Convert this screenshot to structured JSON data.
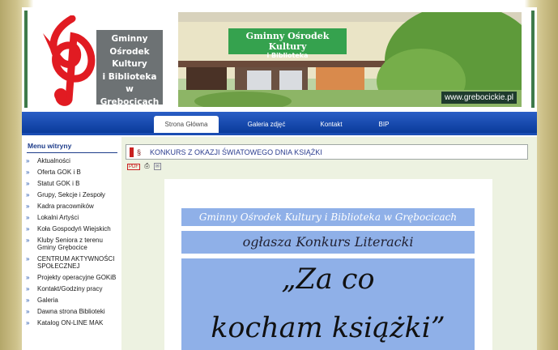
{
  "header": {
    "logo_lines": [
      "Gminny",
      "Ośrodek",
      "Kultury",
      "i Biblioteka",
      "w Grębocicach"
    ],
    "photo_sign_line1": "Gminny Ośrodek Kultury",
    "photo_sign_line2": "i Biblioteka",
    "url_badge": "www.grebocickie.pl"
  },
  "nav": {
    "items": [
      "Strona Główna",
      "Galeria zdjęć",
      "Kontakt",
      "BIP"
    ],
    "active": "Strona Główna"
  },
  "sidebar": {
    "title": "Menu witryny",
    "items": [
      "Aktualności",
      "Oferta GOK i B",
      "Statut GOK i B",
      "Grupy, Sekcje i Zespoły",
      "Kadra pracowników",
      "Lokalni Artyści",
      "Koła Gospodyń Wiejskich",
      "Kluby Seniora z terenu Gminy Grębocice",
      "CENTRUM AKTYWNOŚCI SPOŁECZNEJ",
      "Projekty operacyjne GOKiB",
      "Kontakt/Godziny pracy",
      "Galeria",
      "Dawna strona Biblioteki",
      "Katalog ON-LINE MAK"
    ]
  },
  "article": {
    "title": "KONKURS Z OKAZJI ŚWIATOWEGO DNIA KSIĄŻKI",
    "tools": [
      "pdf-icon",
      "print-icon",
      "email-icon"
    ],
    "poster": {
      "line1": "Gminny Ośrodek Kultury i Biblioteka w Grębocicach",
      "line2": "ogłasza Konkurs Literacki",
      "line3": "„Za co",
      "line4": "kocham książki”"
    }
  },
  "colors": {
    "nav_blue": "#0a3b9b",
    "menu_title": "#1d3c8a",
    "poster_blue": "#8fb0e8",
    "content_bg": "#edf2e1",
    "title_text": "#2b3d8f"
  }
}
